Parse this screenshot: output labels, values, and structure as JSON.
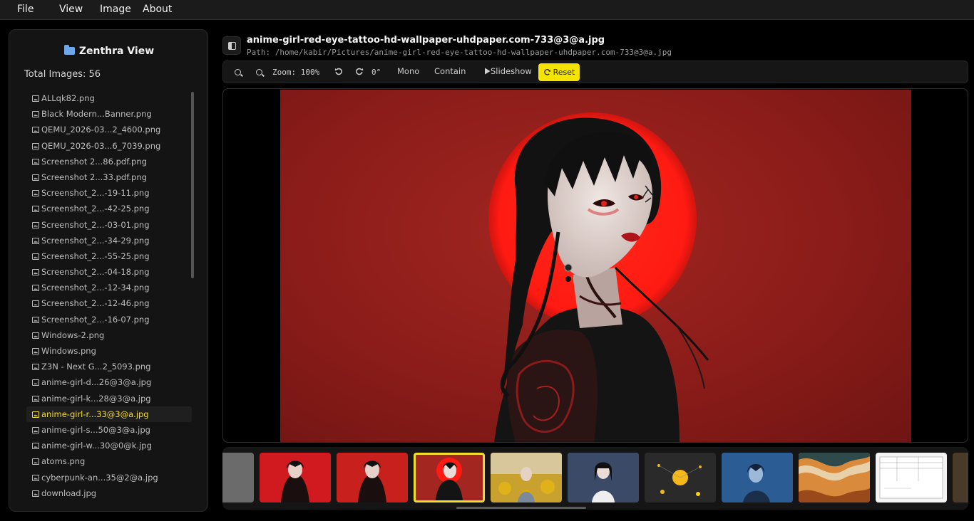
{
  "menu": [
    "File",
    "View",
    "Image",
    "About"
  ],
  "sidebar": {
    "title": "Zenthra View",
    "total": "Total Images: 56",
    "files": [
      "ALLqk82.png",
      "Black Modern...Banner.png",
      "QEMU_2026-03...2_4600.png",
      "QEMU_2026-03...6_7039.png",
      "Screenshot 2...86.pdf.png",
      "Screenshot 2...33.pdf.png",
      "Screenshot_2...-19-11.png",
      "Screenshot_2...-42-25.png",
      "Screenshot_2...-03-01.png",
      "Screenshot_2...-34-29.png",
      "Screenshot_2...-55-25.png",
      "Screenshot_2...-04-18.png",
      "Screenshot_2...-12-34.png",
      "Screenshot_2...-12-46.png",
      "Screenshot_2...-16-07.png",
      "Windows-2.png",
      "Windows.png",
      "Z3N - Next G...2_5093.png",
      "anime-girl-d...26@3@a.jpg",
      "anime-girl-k...28@3@a.jpg",
      "anime-girl-r...33@3@a.jpg",
      "anime-girl-s...50@3@a.jpg",
      "anime-girl-w...30@0@k.jpg",
      "atoms.png",
      "cyberpunk-an...35@2@a.jpg",
      "download.jpg"
    ],
    "active_index": 20
  },
  "header": {
    "filename": "anime-girl-red-eye-tattoo-hd-wallpaper-uhdpaper.com-733@3@a.jpg",
    "path": "Path: /home/kabir/Pictures/anime-girl-red-eye-tattoo-hd-wallpaper-uhdpaper.com-733@3@a.jpg"
  },
  "toolbar": {
    "zoom": "Zoom: 100%",
    "rotation": "0°",
    "mono": "Mono",
    "fit": "Contain",
    "slideshow": "Slideshow",
    "reset": "Reset"
  },
  "icons": {
    "zoom_in": "zoom-in-icon",
    "zoom_out": "zoom-out-icon",
    "rotate_left": "rotate-left-icon",
    "rotate_right": "rotate-right-icon",
    "play": "play-icon",
    "refresh": "refresh-icon",
    "folder": "folder-icon",
    "image": "image-file-icon"
  },
  "colors": {
    "accent": "#f3de2c",
    "reset_bg": "#f5e400",
    "folder": "#6ea8ea",
    "art_background": "#9a221e",
    "sun_halo": "#ff1a12"
  },
  "filmstrip": {
    "active_index": 3,
    "thumbs": [
      {
        "name": "thumb-gray",
        "bg": "#6b6b6b"
      },
      {
        "name": "thumb-red-oni",
        "bg": "#d01a1f"
      },
      {
        "name": "thumb-red-sword",
        "bg": "#c8201c"
      },
      {
        "name": "thumb-red-eye-tattoo",
        "bg": "#a32621"
      },
      {
        "name": "thumb-sunflower",
        "bg": "#c9a12e"
      },
      {
        "name": "thumb-white-dress",
        "bg": "#5a6a86"
      },
      {
        "name": "thumb-atoms",
        "bg": "#2a2a2a"
      },
      {
        "name": "thumb-cyberpunk",
        "bg": "#3a6fa8"
      },
      {
        "name": "thumb-waves",
        "bg": "#c46a27"
      },
      {
        "name": "thumb-document",
        "bg": "#f4f4f4"
      },
      {
        "name": "thumb-partial",
        "bg": "#4a3a2a"
      }
    ]
  }
}
